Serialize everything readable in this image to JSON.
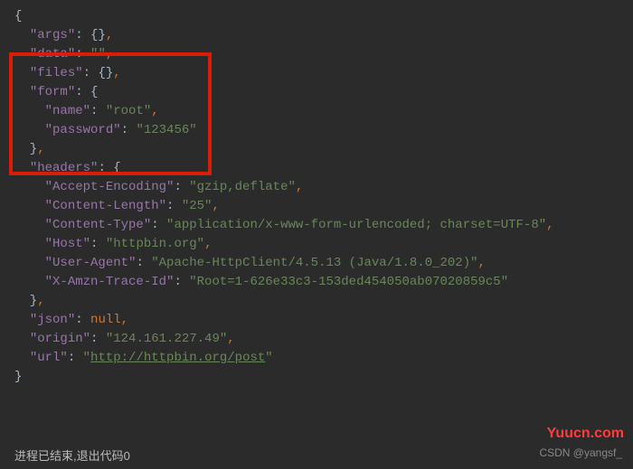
{
  "code": {
    "args_key": "\"args\"",
    "args_val": "{}",
    "data_key": "\"data\"",
    "data_val": "\"\"",
    "files_key": "\"files\"",
    "files_val": "{}",
    "form_key": "\"form\"",
    "form_name_key": "\"name\"",
    "form_name_val": "\"root\"",
    "form_password_key": "\"password\"",
    "form_password_val": "\"123456\"",
    "headers_key": "\"headers\"",
    "ae_key": "\"Accept-Encoding\"",
    "ae_val": "\"gzip,deflate\"",
    "cl_key": "\"Content-Length\"",
    "cl_val": "\"25\"",
    "ct_key": "\"Content-Type\"",
    "ct_val": "\"application/x-www-form-urlencoded; charset=UTF-8\"",
    "host_key": "\"Host\"",
    "host_val": "\"httpbin.org\"",
    "ua_key": "\"User-Agent\"",
    "ua_val": "\"Apache-HttpClient/4.5.13 (Java/1.8.0_202)\"",
    "trace_key": "\"X-Amzn-Trace-Id\"",
    "trace_val": "\"Root=1-626e33c3-153ded454050ab07020859c5\"",
    "json_key": "\"json\"",
    "json_val": "null",
    "origin_key": "\"origin\"",
    "origin_val": "\"124.161.227.49\"",
    "url_key": "\"url\"",
    "url_q": "\"",
    "url_link": "http://httpbin.org/post"
  },
  "footer": {
    "status": "进程已结束,退出代码0",
    "csdn": "CSDN @yangsf_"
  },
  "watermark": "Yuucn.com"
}
